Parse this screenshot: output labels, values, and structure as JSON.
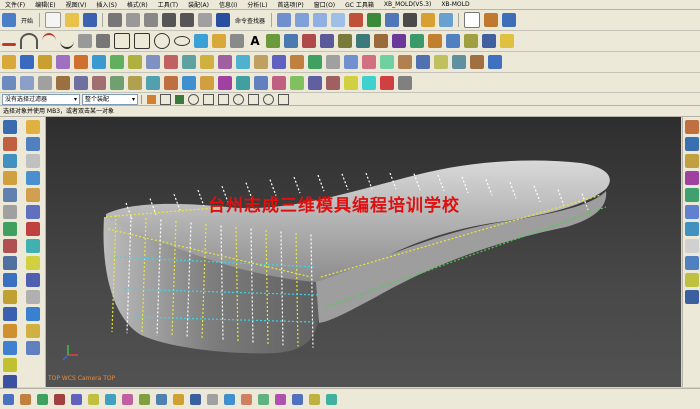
{
  "menu": [
    "文件(F)",
    "编辑(E)",
    "视图(V)",
    "插入(S)",
    "格式(R)",
    "工具(T)",
    "装配(A)",
    "信息(I)",
    "分析(L)",
    "首选项(P)",
    "窗口(O)",
    "GC 工具箱",
    "XB_MOLD(V5.3)",
    "XB-MOLD"
  ],
  "toolbar": {
    "start_label": "开始",
    "command_finder_label": "命令查找器"
  },
  "selection": {
    "filter_value": "没有选择过滤器",
    "scope_value": "整个装配"
  },
  "cue_line": "选择对象并使用 MB3，或者双击某一对象",
  "viewport": {
    "watermark": "台州志成三维模具编程培训学校",
    "caption": "TOP WCS Camera TOP"
  },
  "colors": {
    "accent_red": "#e01010",
    "grid_yellow": "#e8e83a",
    "grid_cyan": "#3ad6e8",
    "grid_white": "#ffffff",
    "grid_green": "#4ad04a"
  }
}
